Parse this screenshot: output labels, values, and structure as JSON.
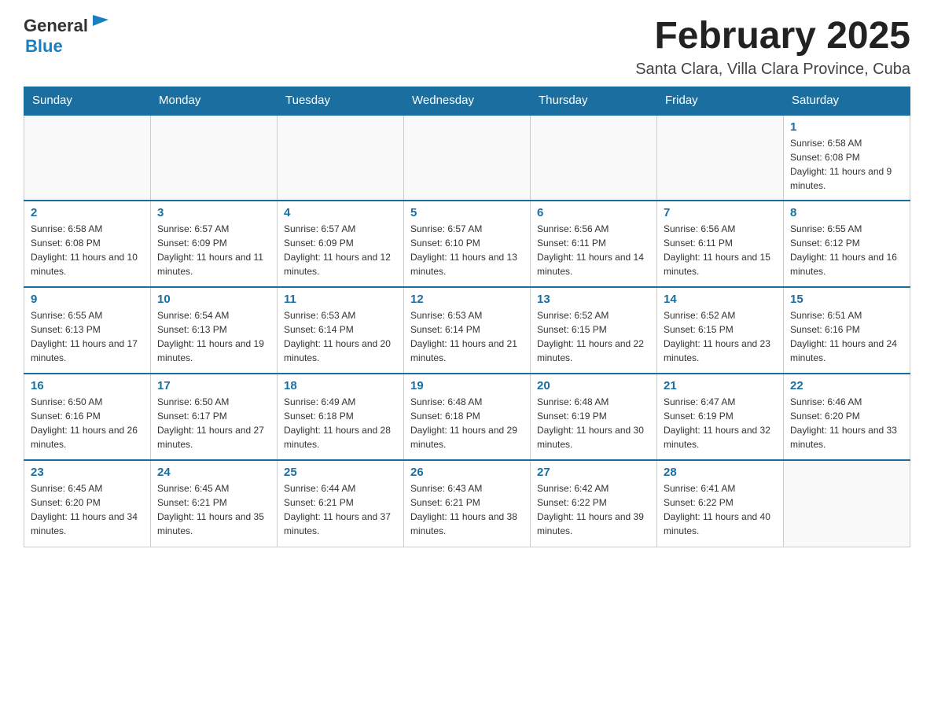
{
  "header": {
    "logo_general": "General",
    "logo_blue": "Blue",
    "month_title": "February 2025",
    "location": "Santa Clara, Villa Clara Province, Cuba"
  },
  "calendar": {
    "days_of_week": [
      "Sunday",
      "Monday",
      "Tuesday",
      "Wednesday",
      "Thursday",
      "Friday",
      "Saturday"
    ],
    "weeks": [
      [
        {
          "day": "",
          "info": ""
        },
        {
          "day": "",
          "info": ""
        },
        {
          "day": "",
          "info": ""
        },
        {
          "day": "",
          "info": ""
        },
        {
          "day": "",
          "info": ""
        },
        {
          "day": "",
          "info": ""
        },
        {
          "day": "1",
          "info": "Sunrise: 6:58 AM\nSunset: 6:08 PM\nDaylight: 11 hours and 9 minutes."
        }
      ],
      [
        {
          "day": "2",
          "info": "Sunrise: 6:58 AM\nSunset: 6:08 PM\nDaylight: 11 hours and 10 minutes."
        },
        {
          "day": "3",
          "info": "Sunrise: 6:57 AM\nSunset: 6:09 PM\nDaylight: 11 hours and 11 minutes."
        },
        {
          "day": "4",
          "info": "Sunrise: 6:57 AM\nSunset: 6:09 PM\nDaylight: 11 hours and 12 minutes."
        },
        {
          "day": "5",
          "info": "Sunrise: 6:57 AM\nSunset: 6:10 PM\nDaylight: 11 hours and 13 minutes."
        },
        {
          "day": "6",
          "info": "Sunrise: 6:56 AM\nSunset: 6:11 PM\nDaylight: 11 hours and 14 minutes."
        },
        {
          "day": "7",
          "info": "Sunrise: 6:56 AM\nSunset: 6:11 PM\nDaylight: 11 hours and 15 minutes."
        },
        {
          "day": "8",
          "info": "Sunrise: 6:55 AM\nSunset: 6:12 PM\nDaylight: 11 hours and 16 minutes."
        }
      ],
      [
        {
          "day": "9",
          "info": "Sunrise: 6:55 AM\nSunset: 6:13 PM\nDaylight: 11 hours and 17 minutes."
        },
        {
          "day": "10",
          "info": "Sunrise: 6:54 AM\nSunset: 6:13 PM\nDaylight: 11 hours and 19 minutes."
        },
        {
          "day": "11",
          "info": "Sunrise: 6:53 AM\nSunset: 6:14 PM\nDaylight: 11 hours and 20 minutes."
        },
        {
          "day": "12",
          "info": "Sunrise: 6:53 AM\nSunset: 6:14 PM\nDaylight: 11 hours and 21 minutes."
        },
        {
          "day": "13",
          "info": "Sunrise: 6:52 AM\nSunset: 6:15 PM\nDaylight: 11 hours and 22 minutes."
        },
        {
          "day": "14",
          "info": "Sunrise: 6:52 AM\nSunset: 6:15 PM\nDaylight: 11 hours and 23 minutes."
        },
        {
          "day": "15",
          "info": "Sunrise: 6:51 AM\nSunset: 6:16 PM\nDaylight: 11 hours and 24 minutes."
        }
      ],
      [
        {
          "day": "16",
          "info": "Sunrise: 6:50 AM\nSunset: 6:16 PM\nDaylight: 11 hours and 26 minutes."
        },
        {
          "day": "17",
          "info": "Sunrise: 6:50 AM\nSunset: 6:17 PM\nDaylight: 11 hours and 27 minutes."
        },
        {
          "day": "18",
          "info": "Sunrise: 6:49 AM\nSunset: 6:18 PM\nDaylight: 11 hours and 28 minutes."
        },
        {
          "day": "19",
          "info": "Sunrise: 6:48 AM\nSunset: 6:18 PM\nDaylight: 11 hours and 29 minutes."
        },
        {
          "day": "20",
          "info": "Sunrise: 6:48 AM\nSunset: 6:19 PM\nDaylight: 11 hours and 30 minutes."
        },
        {
          "day": "21",
          "info": "Sunrise: 6:47 AM\nSunset: 6:19 PM\nDaylight: 11 hours and 32 minutes."
        },
        {
          "day": "22",
          "info": "Sunrise: 6:46 AM\nSunset: 6:20 PM\nDaylight: 11 hours and 33 minutes."
        }
      ],
      [
        {
          "day": "23",
          "info": "Sunrise: 6:45 AM\nSunset: 6:20 PM\nDaylight: 11 hours and 34 minutes."
        },
        {
          "day": "24",
          "info": "Sunrise: 6:45 AM\nSunset: 6:21 PM\nDaylight: 11 hours and 35 minutes."
        },
        {
          "day": "25",
          "info": "Sunrise: 6:44 AM\nSunset: 6:21 PM\nDaylight: 11 hours and 37 minutes."
        },
        {
          "day": "26",
          "info": "Sunrise: 6:43 AM\nSunset: 6:21 PM\nDaylight: 11 hours and 38 minutes."
        },
        {
          "day": "27",
          "info": "Sunrise: 6:42 AM\nSunset: 6:22 PM\nDaylight: 11 hours and 39 minutes."
        },
        {
          "day": "28",
          "info": "Sunrise: 6:41 AM\nSunset: 6:22 PM\nDaylight: 11 hours and 40 minutes."
        },
        {
          "day": "",
          "info": ""
        }
      ]
    ]
  }
}
